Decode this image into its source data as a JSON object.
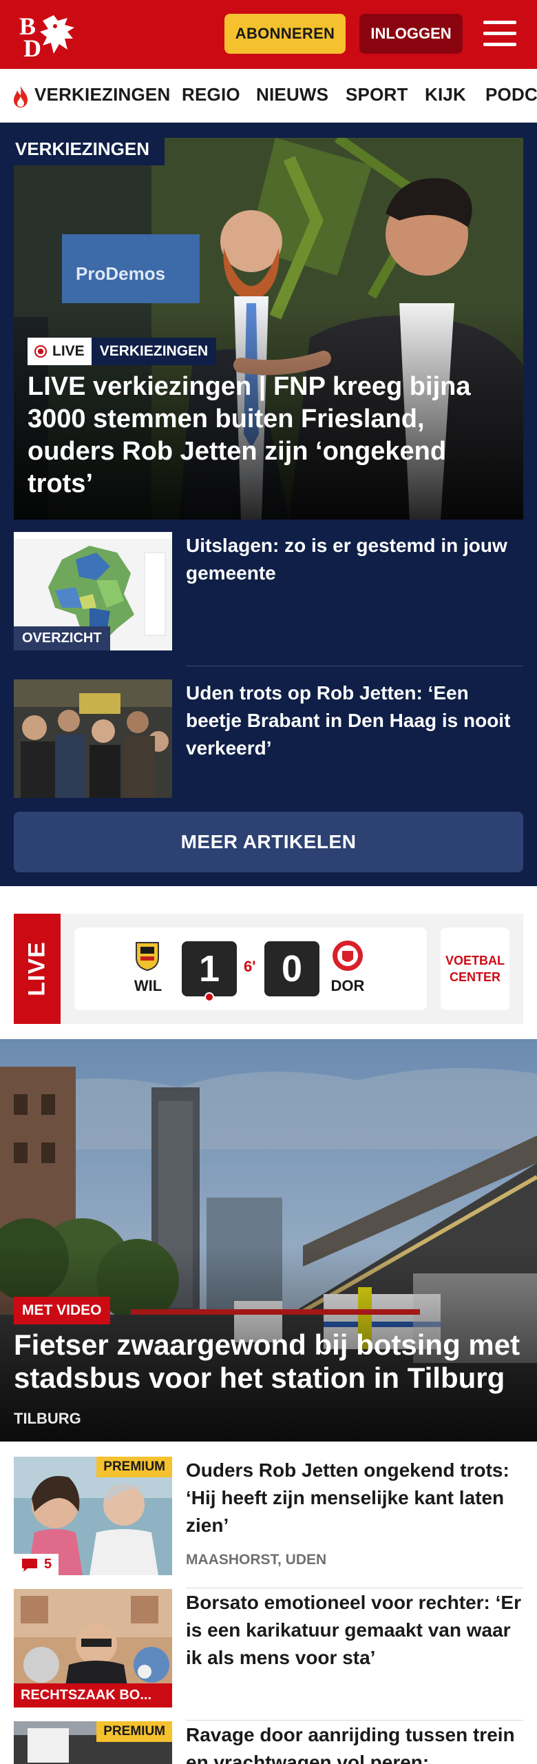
{
  "header": {
    "logo_text": "BD",
    "subscribe_label": "ABONNEREN",
    "login_label": "INLOGGEN",
    "menu_icon": "hamburger-icon",
    "brand_color": "#cc0a14"
  },
  "nav": {
    "items": [
      "VERKIEZINGEN",
      "REGIO",
      "NIEUWS",
      "SPORT",
      "KIJK",
      "PODC"
    ],
    "first_item_icon": "flame-icon"
  },
  "election": {
    "section_label": "VERKIEZINGEN",
    "hero": {
      "live_label": "LIVE",
      "category_label": "VERKIEZINGEN",
      "image_sign_text": "ProDemos",
      "title": "LIVE verkiezingen | FNP kreeg bijna 3000 stemmen buiten Friesland, ouders Rob Jetten zijn ‘ongekend trots’"
    },
    "items": [
      {
        "label": "OVERZICHT",
        "title": "Uitslagen: zo is er gestemd in jouw gemeente"
      },
      {
        "label": "",
        "title": "Uden trots op Rob Jetten: ‘Een beetje Brabant in Den Haag is nooit verkeerd’"
      }
    ],
    "more_label": "MEER ARTIKELEN",
    "bg_color": "#0f1f47"
  },
  "live_score": {
    "live_label": "LIVE",
    "home_code": "WIL",
    "away_code": "DOR",
    "home_score": "1",
    "away_score": "0",
    "minute": "6'",
    "center_label": "VOETBAL CENTER"
  },
  "top_story": {
    "badge": "MET VIDEO",
    "title": "Fietser zwaargewond bij botsing met stadsbus voor het station in Tilburg",
    "location": "TILBURG"
  },
  "articles": [
    {
      "premium": "PREMIUM",
      "comments": "5",
      "title": "Ouders Rob Jetten ongekend trots: ‘Hij heeft zijn menselijke kant laten zien’",
      "meta": "MAASHORST, UDEN",
      "tag": ""
    },
    {
      "premium": "",
      "comments": "",
      "title": "Borsato emotioneel voor rechter: ‘Er is een karikatuur gemaakt van waar ik als mens voor sta’",
      "meta": "",
      "tag": "RECHTSZAAK BO..."
    },
    {
      "premium": "PREMIUM",
      "comments": "",
      "title": "Ravage door aanrijding tussen trein en vrachtwagen vol peren:",
      "meta": "",
      "tag": ""
    }
  ]
}
